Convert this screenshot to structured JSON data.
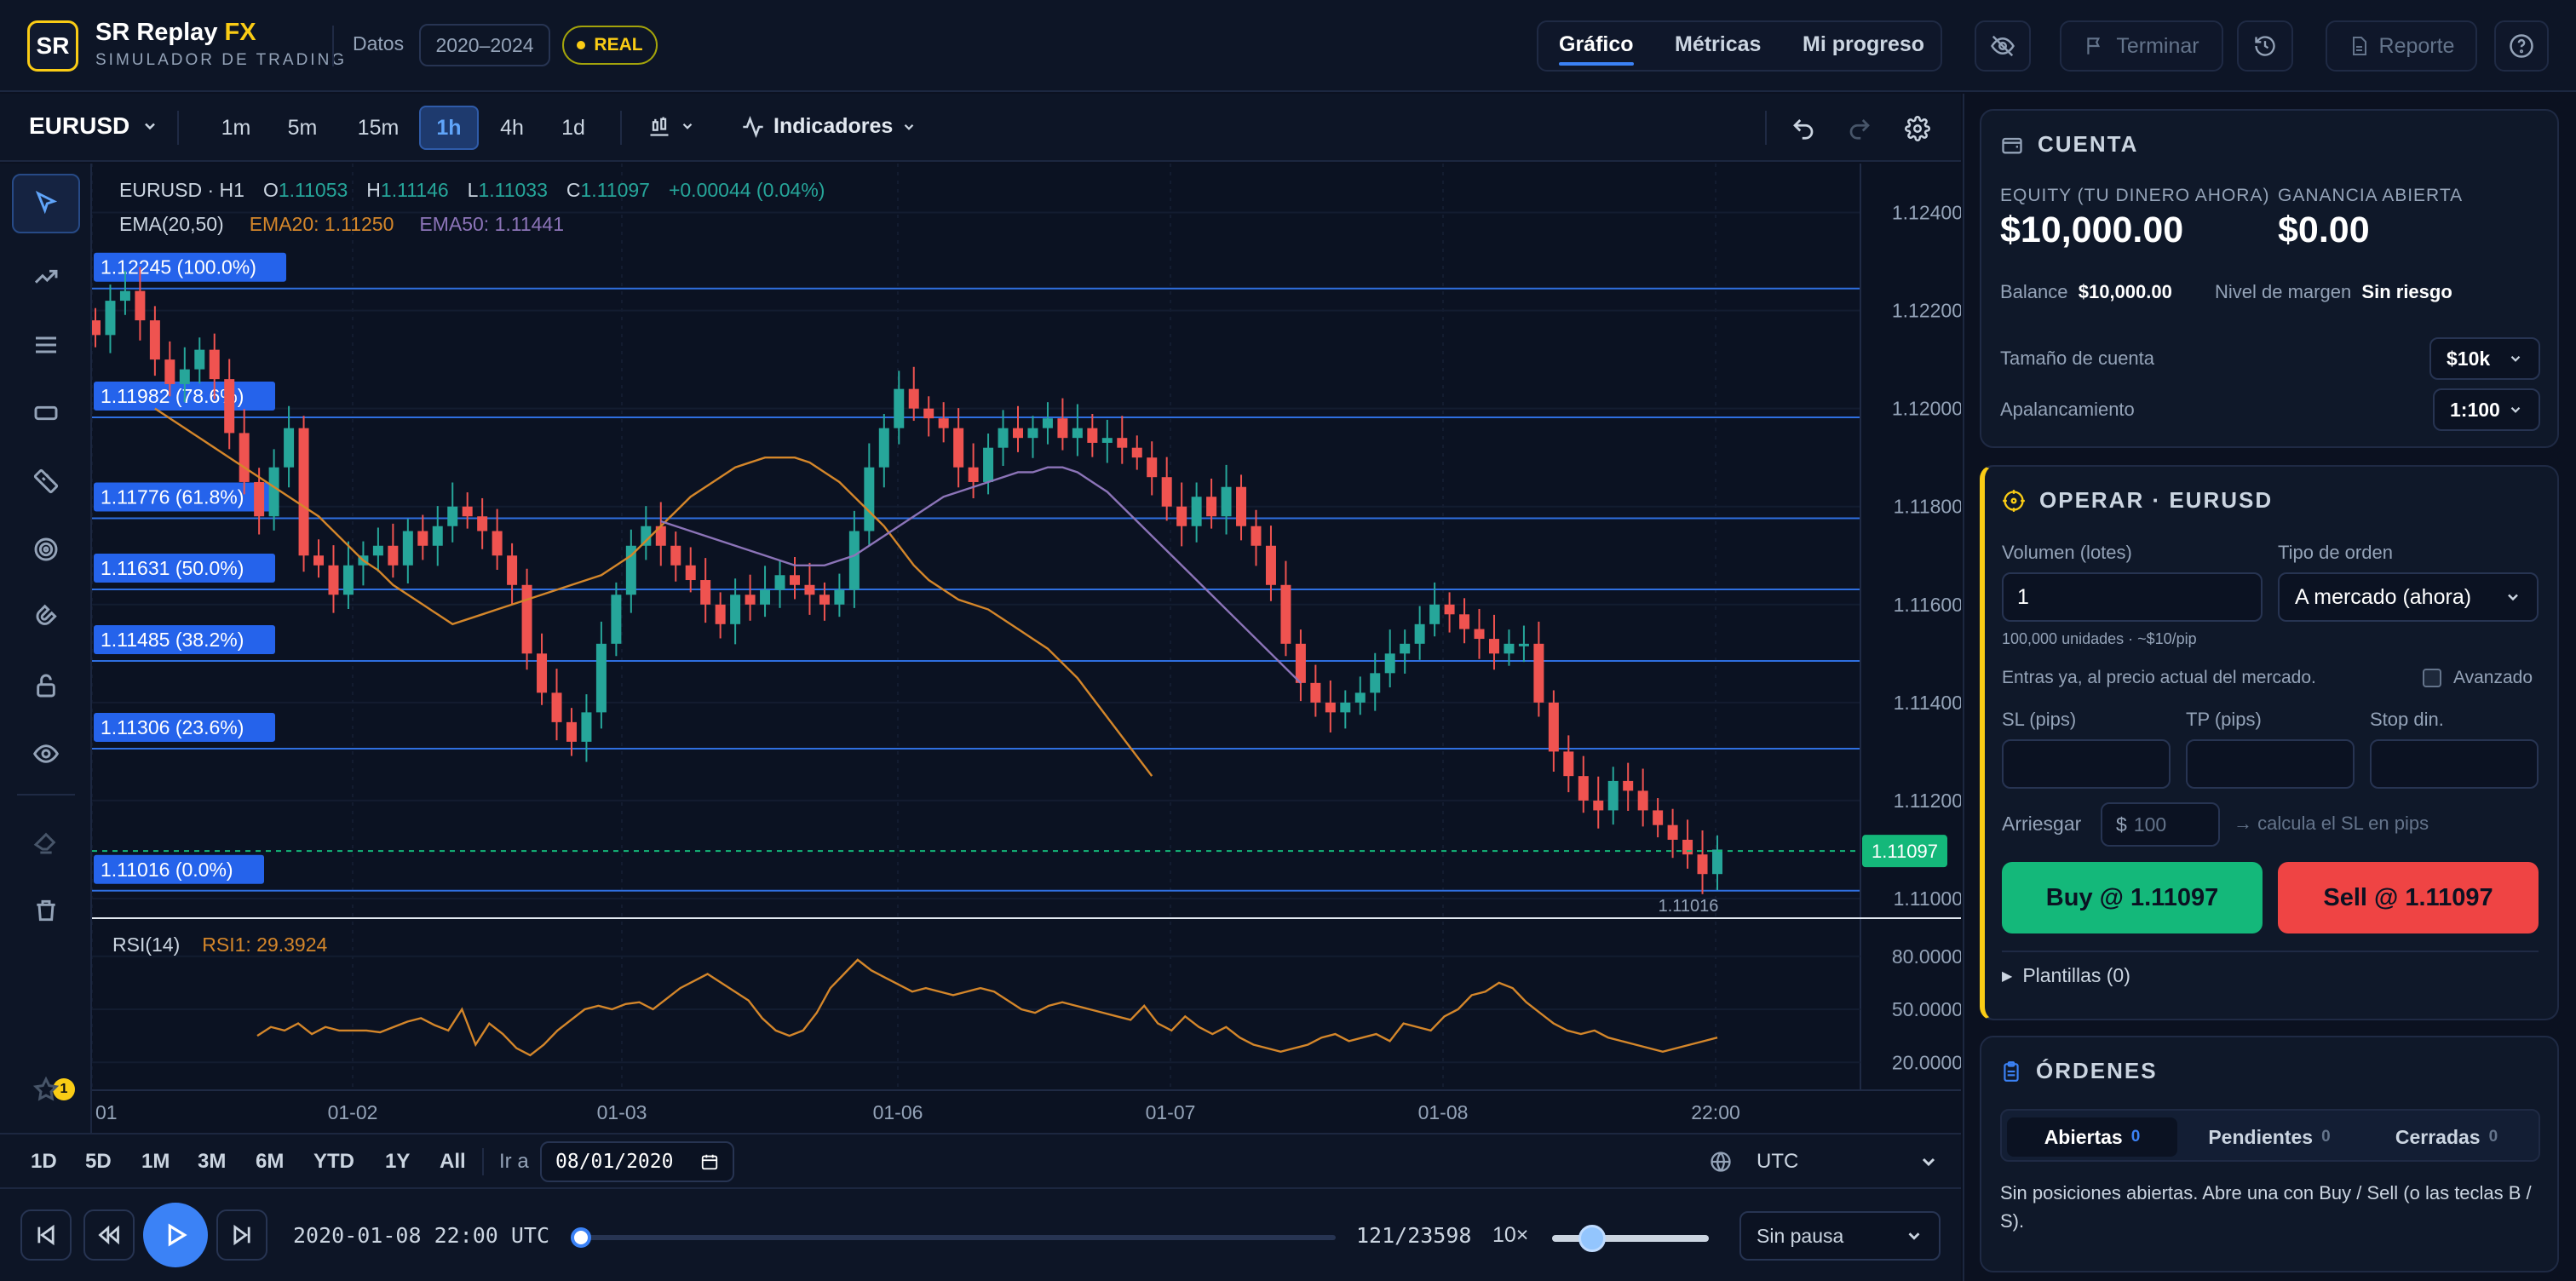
{
  "app": {
    "logo": "SR",
    "brand": "SR Replay",
    "brand_fx": "FX",
    "subtitle": "SIMULADOR DE TRADING",
    "datos_label": "Datos",
    "data_range": "2020–2024",
    "mode_badge": "REAL"
  },
  "nav": {
    "tabs": [
      "Gráfico",
      "Métricas",
      "Mi progreso"
    ],
    "active": "Gráfico",
    "terminar": "Terminar",
    "reporte": "Reporte"
  },
  "toolbar": {
    "symbol": "EURUSD",
    "timeframes": [
      "1m",
      "5m",
      "15m",
      "1h",
      "4h",
      "1d"
    ],
    "active_timeframe": "1h",
    "indicators_label": "Indicadores"
  },
  "legend": {
    "symbol_tf": "EURUSD · H1",
    "o_label": "O",
    "o": "1.11053",
    "h_label": "H",
    "h": "1.11146",
    "l_label": "L",
    "l": "1.11033",
    "c_label": "C",
    "c": "1.11097",
    "change": "+0.00044 (0.04%)",
    "ema_label": "EMA(20,50)",
    "ema20": "EMA20: 1.11250",
    "ema50": "EMA50: 1.11441",
    "rsi_label": "RSI(14)",
    "rsi_value": "RSI1: 29.3924"
  },
  "chart_data": {
    "type": "candlestick",
    "symbol": "EURUSD",
    "timeframe": "H1",
    "y_ticks": [
      "1.12400",
      "1.12200",
      "1.12000",
      "1.11800",
      "1.11600",
      "1.11400",
      "1.11200",
      "1.11000"
    ],
    "ylim": [
      1.1096,
      1.125
    ],
    "x_ticks": [
      "01",
      "01-02",
      "01-03",
      "01-06",
      "01-07",
      "01-08",
      "22:00"
    ],
    "current_price": "1.11097",
    "low_marker": "1.11016",
    "fib_levels": [
      {
        "label": "1.12245 (100.0%)",
        "price": 1.12245
      },
      {
        "label": "1.11982 (78.6%)",
        "price": 1.11982
      },
      {
        "label": "1.11776 (61.8%)",
        "price": 1.11776
      },
      {
        "label": "1.11631 (50.0%)",
        "price": 1.11631
      },
      {
        "label": "1.11485 (38.2%)",
        "price": 1.11485
      },
      {
        "label": "1.11306 (23.6%)",
        "price": 1.11306
      },
      {
        "label": "1.11016 (0.0%)",
        "price": 1.11016
      }
    ],
    "closes": [
      1.1215,
      1.1222,
      1.1224,
      1.1218,
      1.121,
      1.1205,
      1.1208,
      1.1212,
      1.1206,
      1.1195,
      1.1185,
      1.1178,
      1.1188,
      1.1196,
      1.117,
      1.1168,
      1.1162,
      1.1168,
      1.117,
      1.1172,
      1.1168,
      1.1175,
      1.1172,
      1.1176,
      1.118,
      1.1178,
      1.1175,
      1.117,
      1.1164,
      1.115,
      1.1142,
      1.1136,
      1.1132,
      1.1138,
      1.1152,
      1.1162,
      1.1172,
      1.1176,
      1.1172,
      1.1168,
      1.1165,
      1.116,
      1.1156,
      1.1162,
      1.116,
      1.1163,
      1.1166,
      1.1164,
      1.1162,
      1.116,
      1.1163,
      1.1175,
      1.1188,
      1.1196,
      1.1204,
      1.12,
      1.1198,
      1.1196,
      1.1188,
      1.1185,
      1.1192,
      1.1196,
      1.1194,
      1.1196,
      1.1198,
      1.1194,
      1.1196,
      1.1193,
      1.1194,
      1.1192,
      1.119,
      1.1186,
      1.118,
      1.1176,
      1.1182,
      1.1178,
      1.1184,
      1.1176,
      1.1172,
      1.1164,
      1.1152,
      1.1144,
      1.114,
      1.1138,
      1.114,
      1.1142,
      1.1146,
      1.115,
      1.1152,
      1.1156,
      1.116,
      1.1158,
      1.1155,
      1.1153,
      1.115,
      1.1152,
      1.1152,
      1.114,
      1.113,
      1.1125,
      1.112,
      1.1118,
      1.1124,
      1.1122,
      1.1118,
      1.1115,
      1.1112,
      1.1109,
      1.1105,
      1.111
    ],
    "ema20": [
      1.12,
      1.1198,
      1.1196,
      1.1194,
      1.1192,
      1.119,
      1.1188,
      1.1186,
      1.1184,
      1.1182,
      1.118,
      1.1178,
      1.1175,
      1.1172,
      1.1169,
      1.1167,
      1.1164,
      1.1162,
      1.116,
      1.1158,
      1.1156,
      1.1157,
      1.1158,
      1.1159,
      1.116,
      1.1161,
      1.1162,
      1.1163,
      1.1164,
      1.1165,
      1.1166,
      1.1168,
      1.117,
      1.1173,
      1.1176,
      1.1179,
      1.1182,
      1.1184,
      1.1186,
      1.1188,
      1.1189,
      1.119,
      1.119,
      1.119,
      1.1189,
      1.1187,
      1.1185,
      1.1182,
      1.1179,
      1.1176,
      1.1172,
      1.1168,
      1.1165,
      1.1163,
      1.1161,
      1.116,
      1.1159,
      1.1157,
      1.1155,
      1.1153,
      1.1151,
      1.1148,
      1.1145,
      1.1141,
      1.1137,
      1.1133,
      1.1129,
      1.1125
    ],
    "ema20_start_index": 42,
    "ema50": [
      1.1177,
      1.1176,
      1.1175,
      1.1174,
      1.1173,
      1.1172,
      1.1171,
      1.117,
      1.1169,
      1.1168,
      1.1168,
      1.1168,
      1.1169,
      1.117,
      1.1172,
      1.1174,
      1.1176,
      1.1178,
      1.118,
      1.1182,
      1.1183,
      1.1184,
      1.1185,
      1.1186,
      1.1187,
      1.1187,
      1.1188,
      1.1188,
      1.1187,
      1.1185,
      1.1183,
      1.118,
      1.1177,
      1.1174,
      1.1171,
      1.1168,
      1.1165,
      1.1162,
      1.1159,
      1.1156,
      1.1153,
      1.115,
      1.1147,
      1.1144
    ],
    "ema50_start_index": 67,
    "rsi_ticks": [
      "80.0000",
      "50.0000",
      "20.0000"
    ],
    "rsi": [
      35,
      40,
      38,
      42,
      36,
      40,
      38,
      38,
      38,
      37,
      40,
      43,
      45,
      41,
      38,
      50,
      30,
      42,
      36,
      28,
      24,
      30,
      38,
      44,
      50,
      52,
      50,
      53,
      54,
      50,
      56,
      62,
      66,
      70,
      65,
      60,
      55,
      45,
      38,
      35,
      38,
      48,
      62,
      70,
      78,
      72,
      68,
      64,
      60,
      62,
      60,
      58,
      60,
      62,
      60,
      55,
      50,
      48,
      52,
      54,
      52,
      50,
      48,
      46,
      44,
      52,
      42,
      38,
      46,
      40,
      36,
      40,
      34,
      30,
      28,
      26,
      28,
      30,
      34,
      36,
      32,
      34,
      36,
      32,
      42,
      40,
      38,
      46,
      50,
      58,
      60,
      65,
      62,
      54,
      48,
      42,
      38,
      36,
      38,
      34,
      32,
      30,
      28,
      26,
      28,
      30,
      32,
      34
    ]
  },
  "account": {
    "title": "CUENTA",
    "equity_label": "EQUITY (TU DINERO AHORA)",
    "equity": "$10,000.00",
    "open_pnl_label": "GANANCIA ABIERTA",
    "open_pnl": "$0.00",
    "balance_label": "Balance",
    "balance": "$10,000.00",
    "margin_label": "Nivel de margen",
    "margin": "Sin riesgo",
    "size_label": "Tamaño de cuenta",
    "size": "$10k",
    "leverage_label": "Apalancamiento",
    "leverage": "1:100"
  },
  "trade": {
    "title": "OPERAR · EURUSD",
    "volume_label": "Volumen (lotes)",
    "volume": "1",
    "volume_hint": "100,000 unidades · ~$10/pip",
    "order_type_label": "Tipo de orden",
    "order_type": "A mercado (ahora)",
    "market_hint": "Entras ya, al precio actual del mercado.",
    "advanced_label": "Avanzado",
    "sl_label": "SL (pips)",
    "tp_label": "TP (pips)",
    "stop_label": "Stop din.",
    "risk_label": "Arriesgar",
    "risk_currency": "$",
    "risk_placeholder": "100",
    "risk_hint": "→ calcula el SL en pips",
    "buy": "Buy @ 1.11097",
    "sell": "Sell @ 1.11097",
    "templates": "Plantillas (0)"
  },
  "orders": {
    "title": "ÓRDENES",
    "tabs": [
      {
        "label": "Abiertas",
        "count": "0"
      },
      {
        "label": "Pendientes",
        "count": "0"
      },
      {
        "label": "Cerradas",
        "count": "0"
      }
    ],
    "empty": "Sin posiciones abiertas. Abre una con Buy / Sell (o las teclas B / S)."
  },
  "range": {
    "buttons": [
      "1D",
      "5D",
      "1M",
      "3M",
      "6M",
      "YTD",
      "1Y",
      "All"
    ],
    "goto_label": "Ir a",
    "goto_date": "08/01/2020",
    "tz": "UTC"
  },
  "playback": {
    "timestamp": "2020-01-08 22:00 UTC",
    "position": "121/23598",
    "progress": 0.005,
    "speed": "10×",
    "speed_level": 0.18,
    "pause_mode": "Sin pausa"
  },
  "colors": {
    "up": "#26a69a",
    "down": "#ef5350",
    "fib": "#2f6fe0",
    "ema20": "#d4862a",
    "ema50": "#8c74b8",
    "rsi": "#d4862a",
    "accent": "#3b82f6",
    "brand": "#facc15"
  }
}
